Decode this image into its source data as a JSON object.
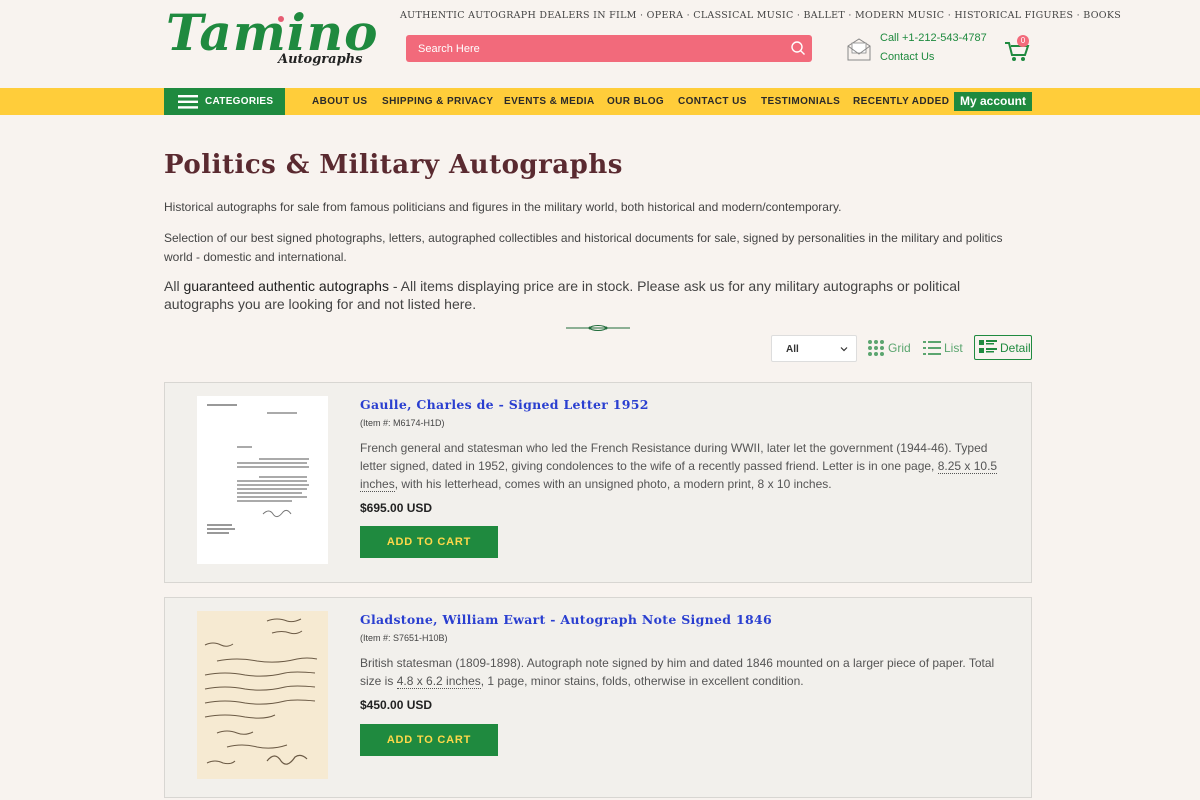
{
  "header": {
    "logo_text": "Tamino",
    "logo_sub": "Autographs",
    "topline": "AUTHENTIC AUTOGRAPH DEALERS IN FILM · OPERA · CLASSICAL MUSIC · BALLET · MODERN MUSIC · HISTORICAL FIGURES · BOOKS",
    "search_placeholder": "Search Here",
    "call_text": "Call +1-212-543-4787",
    "contact_text": "Contact Us",
    "cart_count": "0"
  },
  "nav": {
    "categories_label": "CATEGORIES",
    "items": [
      "ABOUT US",
      "SHIPPING & PRIVACY",
      "EVENTS & MEDIA",
      "OUR BLOG",
      "CONTACT US",
      "TESTIMONIALS",
      "RECENTLY ADDED"
    ],
    "my_account": "My account"
  },
  "page": {
    "title": "Politics & Military Autographs",
    "p1": "Historical autographs for sale from famous politicians and figures in the military world, both historical and modern/contemporary.",
    "p2": "Selection of our best signed photographs, letters, autographed collectibles and historical documents for sale, signed by personalities in the military and politics world - domestic and international.",
    "p3_prefix": "All ",
    "p3_strong": "guaranteed authentic autographs",
    "p3_rest": " - All items displaying price are in stock. Please ask us for any military autographs or political autographs you are looking for and not listed here."
  },
  "toolbar": {
    "filter_value": "All",
    "grid_label": "Grid",
    "list_label": "List",
    "detail_label": "Detail"
  },
  "products": [
    {
      "title": "Gaulle, Charles de - Signed Letter 1952",
      "item": "(Item #: M6174-H1D)",
      "desc_a": "French general and statesman who led the French Resistance during WWII, later let the government (1944-46). Typed letter signed, dated in 1952, giving condolences to the wife of a recently passed friend. Letter is in one page, ",
      "desc_dim": "8.25 x 10.5 inches",
      "desc_b": ", with his letterhead, comes with an unsigned photo, a modern print, 8 x 10 inches.",
      "price": "$695.00 USD",
      "button": "ADD TO CART"
    },
    {
      "title": "Gladstone, William Ewart - Autograph Note Signed 1846",
      "item": "(Item #: S7651-H10B)",
      "desc_a": "British statesman (1809-1898). Autograph note signed by him and dated 1846 mounted on a larger piece of paper. Total size is ",
      "desc_dim": "4.8 x 6.2 inches",
      "desc_b": ", 1 page, minor stains, folds, otherwise in excellent condition.",
      "price": "$450.00 USD",
      "button": "ADD TO CART"
    }
  ],
  "colors": {
    "brand_green": "#1f8a3f",
    "nav_yellow": "#ffcd3a",
    "search_pink": "#f26a7b",
    "title_maroon": "#5a2a30",
    "link_blue": "#2a3fd0"
  }
}
